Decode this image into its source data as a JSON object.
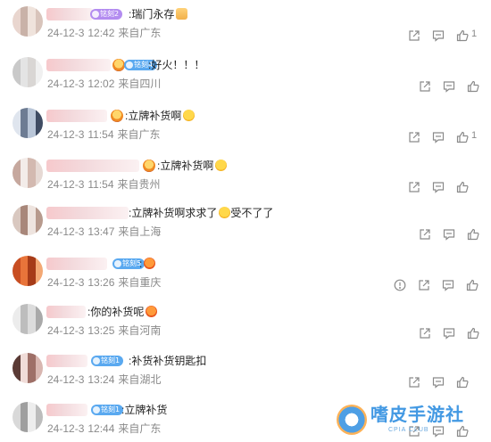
{
  "comments": [
    {
      "content": ":瑞门永存",
      "badge": "铭刻2",
      "badge_color": "#b38cf0",
      "date": "24-12-3",
      "time": "12:42",
      "location": "来自广东",
      "emoji": "hand",
      "actions": [
        "share-icon",
        "reply-icon",
        "like-icon"
      ],
      "like_count": "1"
    },
    {
      "content": ":好火！！！",
      "badge": "铭刻4",
      "badge_color": "#5aa9f0",
      "date": "24-12-3",
      "time": "12:02",
      "location": "来自四川",
      "actions": [
        "share-icon",
        "reply-icon",
        "like-icon"
      ],
      "like_count": ""
    },
    {
      "content": ":立牌补货啊",
      "date": "24-12-3",
      "time": "11:54",
      "location": "来自广东",
      "emoji": "smile",
      "actions": [
        "share-icon",
        "reply-icon",
        "like-icon"
      ],
      "like_count": "1"
    },
    {
      "content": ":立牌补货啊",
      "date": "24-12-3",
      "time": "11:54",
      "location": "来自贵州",
      "emoji": "smile",
      "actions": [
        "share-icon",
        "reply-icon",
        "like-icon"
      ],
      "like_count": ""
    },
    {
      "content": ":立牌补货啊求求了",
      "content_tail": "受不了了",
      "date": "24-12-3",
      "time": "13:47",
      "location": "来自上海",
      "emoji": "cry",
      "actions": [
        "share-icon",
        "reply-icon",
        "like-icon"
      ],
      "like_count": ""
    },
    {
      "content": ":",
      "badge": "铭刻5",
      "badge_color": "#5aa9f0",
      "date": "24-12-3",
      "time": "13:26",
      "location": "来自重庆",
      "emoji": "bag",
      "actions": [
        "warning-icon",
        "share-icon",
        "reply-icon",
        "like-icon"
      ],
      "like_count": ""
    },
    {
      "content": ":你的补货呢",
      "date": "24-12-3",
      "time": "13:25",
      "location": "来自河南",
      "emoji": "red",
      "actions": [
        "share-icon",
        "reply-icon",
        "like-icon"
      ],
      "like_count": ""
    },
    {
      "content": ":补货补货钥匙扣",
      "badge": "铭刻1",
      "badge_color": "#5aa9f0",
      "date": "24-12-3",
      "time": "13:24",
      "location": "来自湖北",
      "actions": [
        "share-icon",
        "reply-icon",
        "like-icon"
      ],
      "like_count": ""
    },
    {
      "content": ":立牌补货",
      "badge": "铭刻1",
      "badge_color": "#5aa9f0",
      "date": "24-12-3",
      "time": "12:44",
      "location": "来自广东",
      "actions": [
        "share-icon",
        "reply-icon",
        "like-icon"
      ],
      "like_count": ""
    }
  ],
  "watermark": {
    "title": "嗜皮手游社",
    "subtitle": "CPIA CLUB"
  },
  "colors": {
    "meta_text": "#8a8a8a",
    "content_text": "#222222",
    "icon": "#8a8a8a"
  }
}
